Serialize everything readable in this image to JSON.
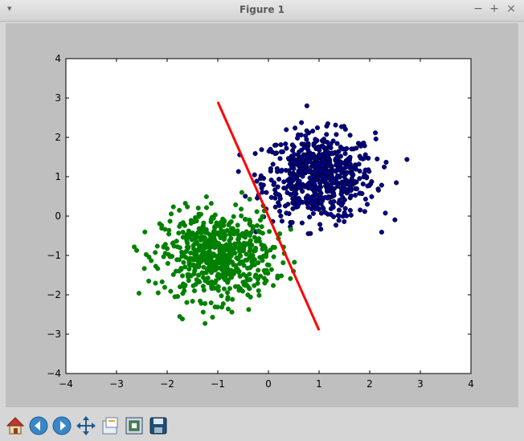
{
  "window": {
    "title": "Figure 1",
    "menu_icon": "chevron-down-icon",
    "controls": [
      "minimize-icon",
      "maximize-icon",
      "close-icon"
    ]
  },
  "toolbar": {
    "buttons": [
      "home-icon",
      "back-arrow-icon",
      "forward-arrow-icon",
      "pan-icon",
      "zoom-to-rect-icon",
      "configure-subplots-icon",
      "save-icon"
    ]
  },
  "colors": {
    "class_blue": "#00008b",
    "class_green": "#008000",
    "boundary": "#ff0000",
    "figure_bg": "#bfbfbf",
    "axes_bg": "#ffffff"
  },
  "chart_data": {
    "type": "scatter",
    "title": "",
    "xlabel": "",
    "ylabel": "",
    "xlim": [
      -4,
      4
    ],
    "ylim": [
      -4,
      4
    ],
    "xticks": [
      "−4",
      "−3",
      "−2",
      "−1",
      "0",
      "1",
      "2",
      "3",
      "4"
    ],
    "yticks": [
      "4",
      "3",
      "2",
      "1",
      "0",
      "−1",
      "−2",
      "−3",
      "−4"
    ],
    "grid": false,
    "series": [
      {
        "color": "#00008b",
        "center": [
          1.0,
          1.0
        ],
        "spread": 0.55,
        "count": 650,
        "x_range": [
          -0.6,
          3.2
        ],
        "y_range": [
          -0.5,
          3.1
        ]
      },
      {
        "color": "#008000",
        "center": [
          -1.0,
          -1.0
        ],
        "spread": 0.55,
        "count": 650,
        "x_range": [
          -3.0,
          1.1
        ],
        "y_range": [
          -3.5,
          1.1
        ]
      }
    ],
    "decision_boundary": {
      "x": [
        -1.0,
        1.0
      ],
      "y": [
        2.9,
        -2.9
      ],
      "color": "#ff0000"
    }
  }
}
